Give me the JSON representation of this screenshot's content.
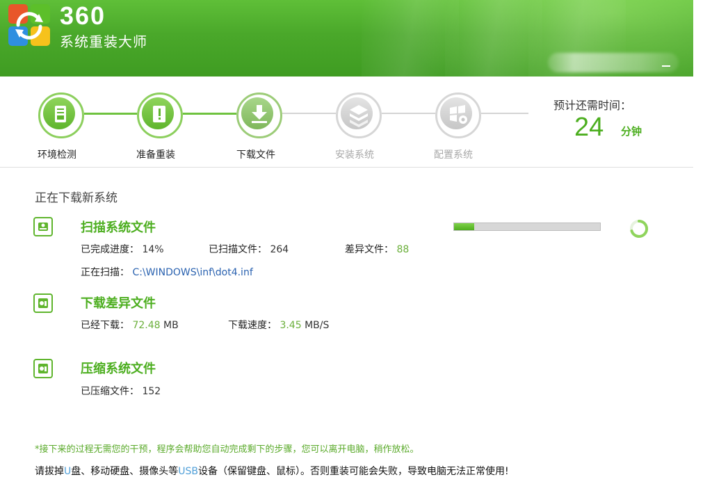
{
  "header": {
    "brand_num": "360",
    "brand_name": "系统重装大师"
  },
  "steps": [
    {
      "label": "环境检测",
      "state": "done"
    },
    {
      "label": "准备重装",
      "state": "done"
    },
    {
      "label": "下载文件",
      "state": "active"
    },
    {
      "label": "安装系统",
      "state": "pending"
    },
    {
      "label": "配置系统",
      "state": "pending"
    }
  ],
  "eta": {
    "label": "预计还需时间：",
    "value": "24",
    "unit": "分钟"
  },
  "section_title": "正在下载新系统",
  "scan": {
    "title": "扫描系统文件",
    "progress_label": "已完成进度：",
    "progress_value": "14%",
    "progress_fraction": 0.14,
    "scanned_label": "已扫描文件：",
    "scanned_value": "264",
    "diff_label": "差异文件：",
    "diff_value": "88",
    "current_label": "正在扫描：",
    "current_value": "C:\\WINDOWS\\inf\\dot4.inf"
  },
  "download": {
    "title": "下载差异文件",
    "downloaded_label": "已经下载：",
    "downloaded_value": "72.48",
    "downloaded_unit": "MB",
    "speed_label": "下载速度：",
    "speed_value": "3.45",
    "speed_unit": "MB/S"
  },
  "compress": {
    "title": "压缩系统文件",
    "compressed_label": "已压缩文件：",
    "compressed_value": "152"
  },
  "notes": {
    "green": "*接下来的过程无需您的干预，程序会帮助您自动完成剩下的步骤，您可以离开电脑，稍作放松。",
    "black_1": "请拔掉",
    "black_u": "U",
    "black_2": "盘、移动硬盘、摄像头等",
    "black_usb": "USB",
    "black_3": "设备（保留键盘、鼠标）。否则重装可能会失败，导致电脑无法正常使用!"
  },
  "colors": {
    "accent": "#4cae1f",
    "header": "#4aa82a",
    "link": "#2a62b0"
  }
}
